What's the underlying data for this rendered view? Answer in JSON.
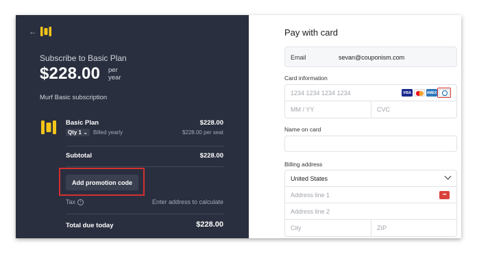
{
  "summary": {
    "heading": "Subscribe to Basic Plan",
    "price": "$228.00",
    "per_line1": "per",
    "per_line2": "year",
    "subscription_name": "Murf Basic subscription",
    "item": {
      "name": "Basic Plan",
      "price": "$228.00",
      "qty": "Qty 1",
      "billing": "Billed yearly",
      "per_seat": "$228.00 per seat"
    },
    "subtotal_label": "Subtotal",
    "subtotal_value": "$228.00",
    "promo_button": "Add promotion code",
    "tax_label": "Tax",
    "tax_value": "Enter address to calculate",
    "total_label": "Total due today",
    "total_value": "$228.00"
  },
  "payment": {
    "title": "Pay with card",
    "email_label": "Email",
    "email_value": "sevan@couponism.com",
    "card_info_label": "Card information",
    "card_number_placeholder": "1234 1234 1234 1234",
    "expiry_placeholder": "MM / YY",
    "cvc_placeholder": "CVC",
    "card_brands": [
      "VISA",
      "mastercard",
      "AMEX",
      "diners"
    ],
    "name_label": "Name on card",
    "billing_label": "Billing address",
    "country": "United States",
    "address1_placeholder": "Address line 1",
    "address2_placeholder": "Address line 2",
    "city_placeholder": "City",
    "zip_placeholder": "ZIP"
  },
  "colors": {
    "panel_dark": "#2a2f3f",
    "brand_yellow": "#f5c518",
    "highlight_red": "#d63030"
  }
}
